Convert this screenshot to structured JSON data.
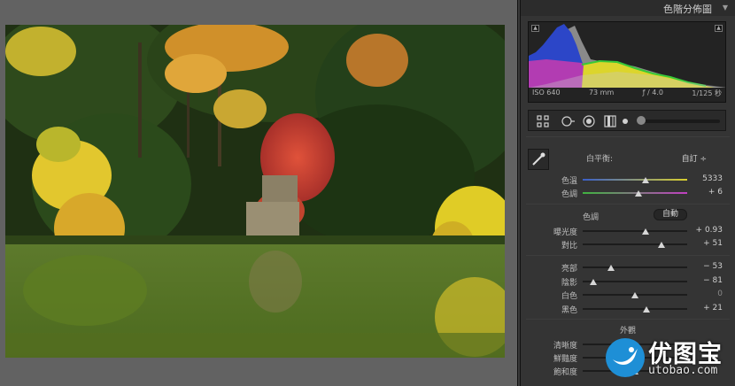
{
  "panel": {
    "title": "色階分佈圖"
  },
  "histogram": {
    "iso": "ISO 640",
    "focal": "73 mm",
    "aperture": "ƒ / 4.0",
    "shutter": "1/125 秒"
  },
  "white_balance": {
    "label": "白平衡:",
    "value": "自訂 ÷",
    "temp": {
      "label": "色溫",
      "value": "5333",
      "position": 0.6
    },
    "tint": {
      "label": "色調",
      "value": "+ 6",
      "position": 0.53
    }
  },
  "tone": {
    "label": "色調",
    "auto": "自動",
    "exposure": {
      "label": "曝光度",
      "value": "+ 0.93",
      "position": 0.6
    },
    "contrast": {
      "label": "對比",
      "value": "+ 51",
      "position": 0.75
    },
    "highlights": {
      "label": "亮部",
      "value": "− 53",
      "position": 0.27
    },
    "shadows": {
      "label": "陰影",
      "value": "− 81",
      "position": 0.1
    },
    "whites": {
      "label": "白色",
      "value": "0",
      "position": 0.5
    },
    "blacks": {
      "label": "黑色",
      "value": "+ 21",
      "position": 0.61
    }
  },
  "presence": {
    "label": "外觀",
    "clarity": {
      "label": "清晰度",
      "position": 0.5
    },
    "vibrance": {
      "label": "鮮豔度",
      "position": 0.5
    },
    "saturation": {
      "label": "飽和度",
      "position": 0.5
    }
  },
  "watermark": {
    "name": "优图宝",
    "url": "utobao.com"
  },
  "colors": {
    "panel_bg": "#343434",
    "canvas_bg": "#626262",
    "histogram_blue": "#2c46c8",
    "histogram_yellow": "#dcd52c",
    "histogram_green": "#38c838",
    "histogram_magenta": "#b23cb2"
  }
}
